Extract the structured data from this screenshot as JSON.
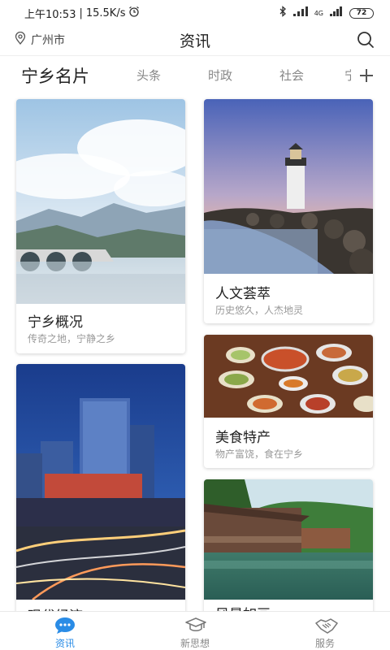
{
  "status_bar": {
    "time": "上午10:53",
    "speed": "15.5K/s",
    "network": "4G",
    "battery": "72"
  },
  "header": {
    "location": "广州市",
    "title": "资讯"
  },
  "tabs": [
    {
      "label": "宁乡名片",
      "active": true
    },
    {
      "label": "头条",
      "active": false
    },
    {
      "label": "时政",
      "active": false
    },
    {
      "label": "社会",
      "active": false
    },
    {
      "label": "宁",
      "active": false
    }
  ],
  "cards": [
    {
      "title": "宁乡概况",
      "subtitle": "传奇之地，宁静之乡"
    },
    {
      "title": "人文荟萃",
      "subtitle": "历史悠久，人杰地灵"
    },
    {
      "title": "现代经济",
      "subtitle": ""
    },
    {
      "title": "美食特产",
      "subtitle": "物产富饶，食在宁乡"
    },
    {
      "title": "风景如画",
      "subtitle": ""
    }
  ],
  "bottom_nav": [
    {
      "label": "资讯",
      "icon": "news-chat-icon",
      "active": true
    },
    {
      "label": "新思想",
      "icon": "graduation-cap-icon",
      "active": false
    },
    {
      "label": "服务",
      "icon": "handshake-icon",
      "active": false
    }
  ],
  "colors": {
    "accent": "#2a8ce6",
    "inactive": "#888888"
  }
}
